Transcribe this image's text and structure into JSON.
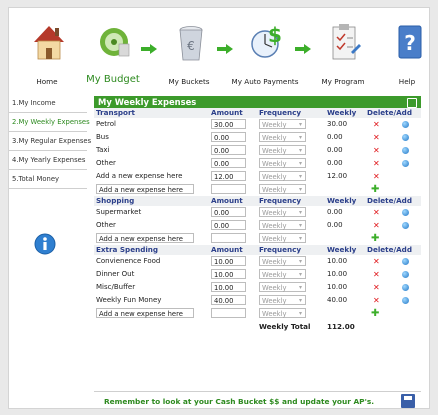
{
  "nav": {
    "items": [
      {
        "label": "Home"
      },
      {
        "label": "My Budget"
      },
      {
        "label": "My Buckets"
      },
      {
        "label": "My Auto Payments"
      },
      {
        "label": "My Program"
      },
      {
        "label": "Help"
      }
    ]
  },
  "sidebar": {
    "items": [
      {
        "label": "1.My Income"
      },
      {
        "label": "2.My Weekly Expenses"
      },
      {
        "label": "3.My Regular Expenses"
      },
      {
        "label": "4.My Yearly Expenses"
      },
      {
        "label": "5.Total Money"
      }
    ]
  },
  "panel": {
    "title": "My Weekly Expenses",
    "columns": {
      "amount": "Amount",
      "frequency": "Frequency",
      "weekly": "Weekly",
      "delete_add": "Delete/Add"
    },
    "sections": [
      {
        "name": "Transport",
        "rows": [
          {
            "label": "Petrol",
            "amount": "30.00",
            "frequency": "Weekly",
            "weekly": "30.00"
          },
          {
            "label": "Bus",
            "amount": "0.00",
            "frequency": "Weekly",
            "weekly": "0.00"
          },
          {
            "label": "Taxi",
            "amount": "0.00",
            "frequency": "Weekly",
            "weekly": "0.00"
          },
          {
            "label": "Other",
            "amount": "0.00",
            "frequency": "Weekly",
            "weekly": "0.00"
          },
          {
            "label": "Add a new expense here",
            "amount": "12.00",
            "frequency": "Weekly",
            "weekly": "12.00"
          }
        ],
        "new_placeholder": "Add a new expense here",
        "new_frequency": "Weekly"
      },
      {
        "name": "Shopping",
        "rows": [
          {
            "label": "Supermarket",
            "amount": "0.00",
            "frequency": "Weekly",
            "weekly": "0.00"
          },
          {
            "label": "Other",
            "amount": "0.00",
            "frequency": "Weekly",
            "weekly": "0.00"
          }
        ],
        "new_placeholder": "Add a new expense here",
        "new_frequency": "Weekly"
      },
      {
        "name": "Extra Spending",
        "rows": [
          {
            "label": "Convienence Food",
            "amount": "10.00",
            "frequency": "Weekly",
            "weekly": "10.00"
          },
          {
            "label": "Dinner Out",
            "amount": "10.00",
            "frequency": "Weekly",
            "weekly": "10.00"
          },
          {
            "label": "Misc/Buffer",
            "amount": "10.00",
            "frequency": "Weekly",
            "weekly": "10.00"
          },
          {
            "label": "Weekly Fun Money",
            "amount": "40.00",
            "frequency": "Weekly",
            "weekly": "40.00"
          }
        ],
        "new_placeholder": "Add a new expense here",
        "new_frequency": "Weekly"
      }
    ],
    "total_label": "Weekly Total",
    "total_value": "112.00",
    "delete_glyph": "✕",
    "add_glyph": "✚"
  },
  "footer": {
    "message": "Remember to look at your Cash Bucket $$ and update your AP's."
  },
  "colors": {
    "accent_green": "#3c9a2b",
    "section_blue": "#2b3f8a",
    "delete_red": "#e0171b"
  }
}
